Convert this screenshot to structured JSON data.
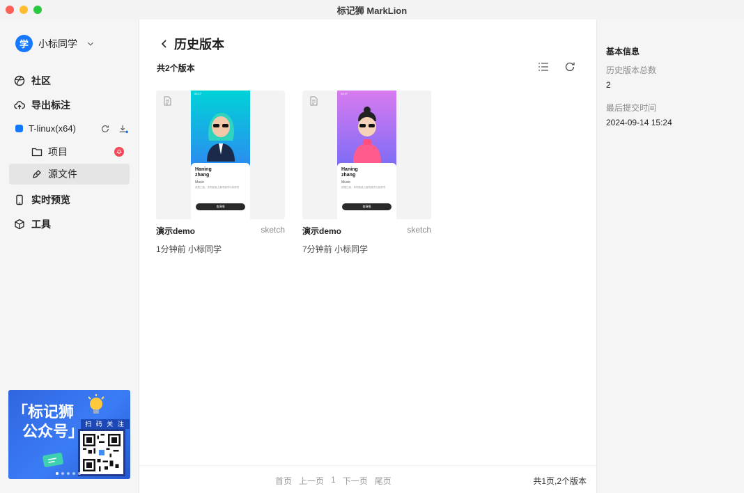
{
  "window": {
    "title": "标记狮 MarkLion"
  },
  "sidebar": {
    "user": {
      "avatar_text": "学",
      "name": "小标同学"
    },
    "nav": {
      "community": "社区",
      "export": "导出标注",
      "preview": "实时预览",
      "tools": "工具"
    },
    "workspace": {
      "name": "T-linux(x64)"
    },
    "sub_items": {
      "project": "项目",
      "source": "源文件"
    },
    "banner": {
      "title_line1": "「标记狮",
      "title_line2": "公众号」",
      "scan": "扫 码 关 注"
    }
  },
  "main": {
    "title": "历史版本",
    "count_label": "共2个版本",
    "cards": [
      {
        "name": "演示demo",
        "type": "sketch",
        "meta": "1分钟前 小标同学",
        "mock_name1": "Haning",
        "mock_name2": "zhang",
        "mock_music": "Music",
        "mock_desc": "我是乙我，来吧我我上面吧我吧与我来吧",
        "mock_btn": "查演唱",
        "mock_time": "09:27"
      },
      {
        "name": "演示demo",
        "type": "sketch",
        "meta": "7分钟前 小标同学",
        "mock_name1": "Haning",
        "mock_name2": "zhang",
        "mock_music": "Music",
        "mock_desc": "我是乙我，来吧我我上面吧我吧与我来吧",
        "mock_btn": "查演唱",
        "mock_time": "09:27"
      }
    ],
    "pager": {
      "first": "首页",
      "prev": "上一页",
      "current": "1",
      "next": "下一页",
      "last": "尾页"
    },
    "total": "共1页,2个版本"
  },
  "right_panel": {
    "title": "基本信息",
    "total_label": "历史版本总数",
    "total_value": "2",
    "last_label": "最后提交时间",
    "last_value": "2024-09-14 15:24"
  },
  "colors": {
    "accent": "#1677ff",
    "badge": "#f5475a"
  }
}
